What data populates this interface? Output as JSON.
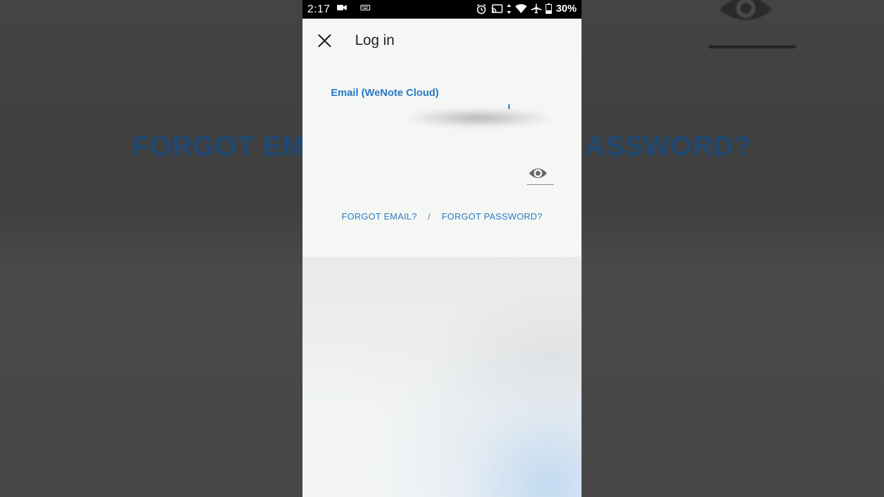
{
  "status_bar": {
    "time": "2:17",
    "battery": "30%"
  },
  "background": {
    "blurred_text_left": "FORGOT EM",
    "blurred_text_right": "ASSWORD?"
  },
  "app_bar": {
    "title": "Log in",
    "close_icon": "close-icon"
  },
  "form": {
    "email_label": "Email (WeNote Cloud)",
    "email_value": "",
    "password_value": ""
  },
  "links": {
    "forgot_email": "FORGOT EMAIL?",
    "separator": "/",
    "forgot_password": "FORGOT PASSWORD?"
  },
  "colors": {
    "accent": "#2a78c2",
    "status_bar": "#000000",
    "screen_bg": "#f4f7f4"
  }
}
